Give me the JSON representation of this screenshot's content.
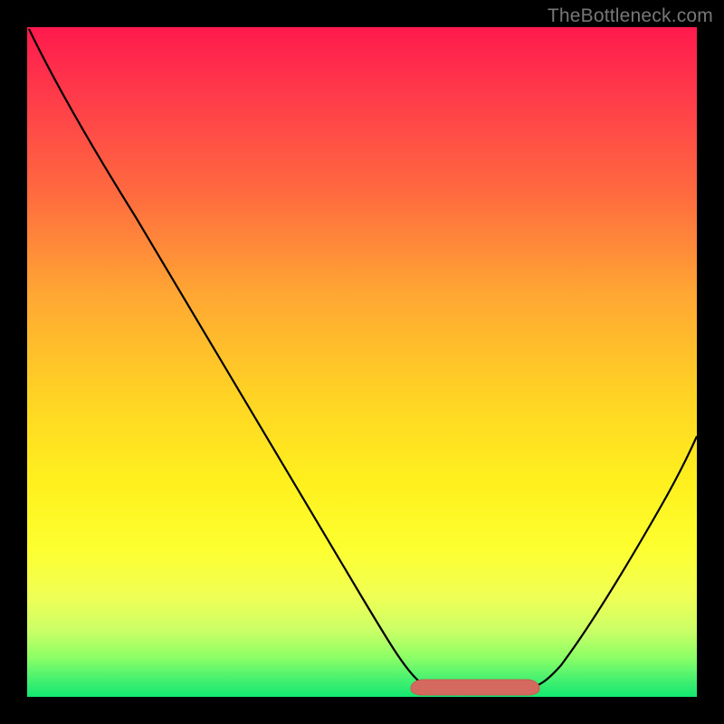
{
  "watermark": "TheBottleneck.com",
  "chart_data": {
    "type": "line",
    "title": "",
    "xlabel": "",
    "ylabel": "",
    "xlim": [
      0,
      100
    ],
    "ylim": [
      0,
      100
    ],
    "series": [
      {
        "name": "bottleneck-curve",
        "x": [
          0,
          5,
          10,
          15,
          20,
          25,
          30,
          35,
          40,
          45,
          50,
          55,
          57,
          60,
          63,
          67,
          70,
          73,
          76,
          80,
          84,
          88,
          92,
          96,
          100
        ],
        "y": [
          100,
          93,
          86,
          79,
          71,
          63,
          55,
          47,
          39,
          30,
          21,
          11,
          7,
          3,
          1,
          0,
          0,
          0,
          1,
          4,
          10,
          18,
          27,
          37,
          48
        ]
      },
      {
        "name": "estimated-optimal-band",
        "x": [
          57,
          76
        ],
        "y": [
          0,
          0
        ]
      }
    ],
    "colors": {
      "curve": "#000000",
      "band": "#d46a5f",
      "gradient_top": "#ff1a4d",
      "gradient_bottom": "#13e870"
    }
  }
}
